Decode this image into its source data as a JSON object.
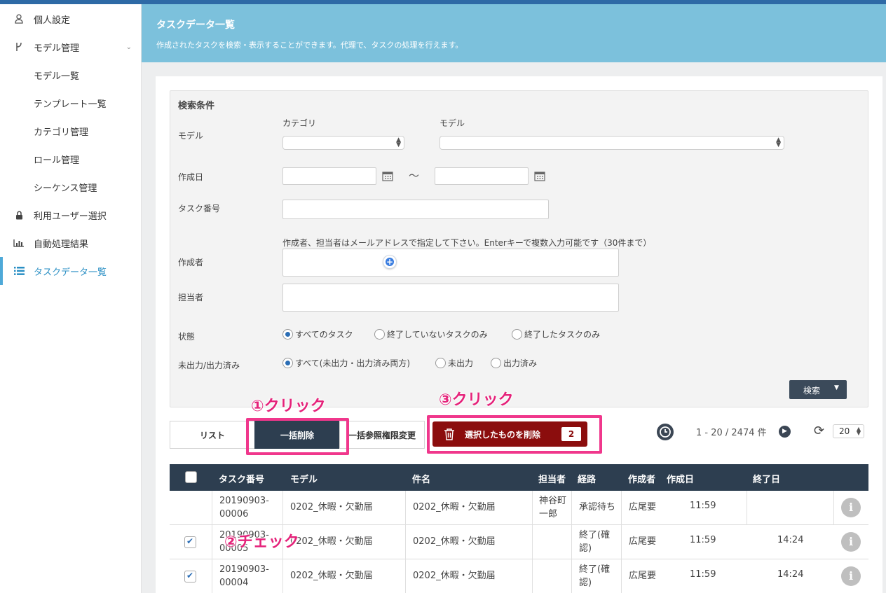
{
  "sidebar": {
    "items": [
      {
        "label": "個人設定",
        "icon": "user-icon"
      },
      {
        "label": "モデル管理",
        "icon": "model-icon"
      },
      {
        "label": "モデル一覧"
      },
      {
        "label": "テンプレート一覧"
      },
      {
        "label": "カテゴリ管理"
      },
      {
        "label": "ロール管理"
      },
      {
        "label": "シーケンス管理"
      },
      {
        "label": "利用ユーザー選択",
        "icon": "lock-icon"
      },
      {
        "label": "自動処理結果",
        "icon": "bar-chart-icon"
      },
      {
        "label": "タスクデータ一覧",
        "icon": "list-icon",
        "active": true
      }
    ]
  },
  "header": {
    "title": "タスクデータ一覧",
    "description": "作成されたタスクを検索・表示することができます。代理で、タスクの処理を行えます。"
  },
  "search": {
    "title": "検索条件",
    "model_label": "モデル",
    "category_label": "カテゴリ",
    "model_sub_label": "モデル",
    "created_label": "作成日",
    "range_sep": "〜",
    "task_no_label": "タスク番号",
    "hint": "作成者、担当者はメールアドレスで指定して下さい。Enterキーで複数入力可能です（30件まで）",
    "creator_label": "作成者",
    "assignee_label": "担当者",
    "status_label": "状態",
    "status_options": [
      "すべてのタスク",
      "終了していないタスクのみ",
      "終了したタスクのみ"
    ],
    "status_selected": 0,
    "output_label": "未出力/出力済み",
    "output_options": [
      "すべて(未出力・出力済み両方)",
      "未出力",
      "出力済み"
    ],
    "output_selected": 0,
    "search_button": "検索"
  },
  "tabs": {
    "list": "リスト",
    "bulk_delete": "一括削除",
    "bulk_perm": "一括参照権限変更"
  },
  "delete_button": {
    "label": "選択したものを削除",
    "count": "2"
  },
  "pager": {
    "range": "1 - 20 / 2474 件",
    "per_page": "20"
  },
  "annotations": {
    "step1": "①クリック",
    "step2": "②チェック",
    "step3": "③クリック",
    "color": "#e5227a"
  },
  "table": {
    "headers": [
      "タスク番号",
      "モデル",
      "件名",
      "担当者",
      "経路",
      "作成者",
      "作成日",
      "終了日"
    ],
    "rows": [
      {
        "checked": false,
        "task_no_1": "20190903-",
        "task_no_2": "00006",
        "model": "0202_休暇・欠勤届",
        "subject": "0202_休暇・欠勤届",
        "assignee_1": "神谷町",
        "assignee_2": "一郎",
        "route_1": "承認待ち",
        "route_2": "",
        "creator": "広尾要",
        "created": "11:59",
        "ended": ""
      },
      {
        "checked": true,
        "task_no_1": "20190903-",
        "task_no_2": "00005",
        "model": "0202_休暇・欠勤届",
        "subject": "0202_休暇・欠勤届",
        "assignee_1": "",
        "assignee_2": "",
        "route_1": "終了(確",
        "route_2": "認)",
        "creator": "広尾要",
        "created": "11:59",
        "ended": "14:24"
      },
      {
        "checked": true,
        "task_no_1": "20190903-",
        "task_no_2": "00004",
        "model": "0202_休暇・欠勤届",
        "subject": "0202_休暇・欠勤届",
        "assignee_1": "",
        "assignee_2": "",
        "route_1": "終了(確",
        "route_2": "認)",
        "creator": "広尾要",
        "created": "11:59",
        "ended": "14:24"
      }
    ]
  },
  "colors": {
    "header_bg": "#7cc1dc",
    "dark_navy": "#2d3e50",
    "delete_red": "#8b0d0d",
    "highlight_pink": "#f0378c",
    "active_blue": "#2a8fc4"
  }
}
